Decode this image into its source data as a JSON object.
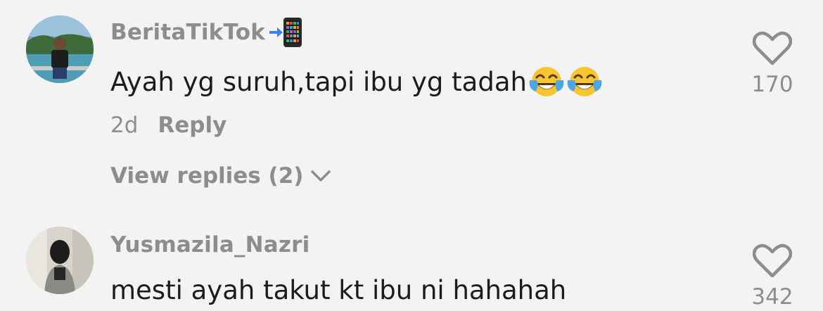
{
  "comments": [
    {
      "username": "BeritaTikTok",
      "username_suffix_icon": "mobile-phone-arrow-icon",
      "text": "Ayah yg suruh,tapi ibu yg tadah",
      "text_emojis": [
        "face-with-tears-of-joy-icon",
        "face-with-tears-of-joy-icon"
      ],
      "time": "2d",
      "reply_label": "Reply",
      "view_replies_label": "View replies (2)",
      "likes": "170"
    },
    {
      "username": "Yusmazila_Nazri",
      "text": "mesti ayah takut kt ibu ni hahahah",
      "likes": "342"
    }
  ],
  "colors": {
    "background": "#f3f3f3",
    "muted_text": "#8d8d8d",
    "body_text": "#1c1c1c"
  }
}
